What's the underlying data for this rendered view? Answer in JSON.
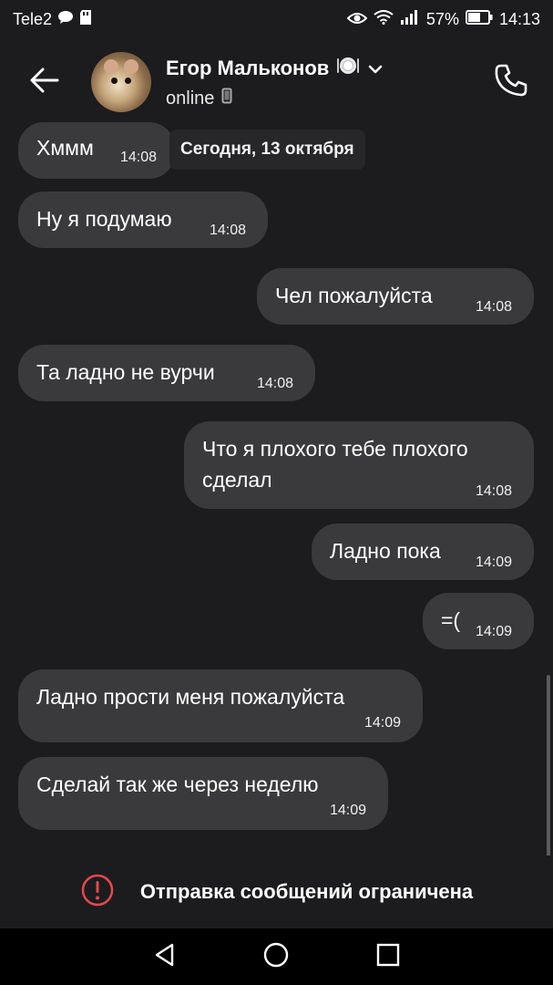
{
  "status_bar": {
    "carrier": "Tele2",
    "battery": "57%",
    "time": "14:13"
  },
  "header": {
    "contact_name": "Егор Мальконов",
    "status": "online"
  },
  "date_chip": "Сегодня, 13 октября",
  "messages": [
    {
      "text": "Хммм",
      "time": "14:08",
      "outgoing": false
    },
    {
      "text": "Ну я подумаю",
      "time": "14:08",
      "outgoing": false
    },
    {
      "text": "Чел пожалуйста",
      "time": "14:08",
      "outgoing": true
    },
    {
      "text": "Та ладно не вурчи",
      "time": "14:08",
      "outgoing": false
    },
    {
      "text_line1": "Что я плохого тебе плохого",
      "text_line2": "сделал",
      "time": "14:08",
      "outgoing": true
    },
    {
      "text": "Ладно пока",
      "time": "14:09",
      "outgoing": true
    },
    {
      "text": "=(",
      "time": "14:09",
      "outgoing": true
    },
    {
      "text": "Ладно прости меня пожалуйста",
      "time": "14:09",
      "outgoing": false
    },
    {
      "text": "Сделай так же через неделю",
      "time": "14:09",
      "outgoing": false
    }
  ],
  "banner": {
    "text": "Отправка сообщений ограничена",
    "accent_color": "#e5484d"
  },
  "icons": {
    "back": "arrow-left-icon",
    "call": "phone-icon",
    "warning": "exclamation-circle-icon",
    "nav_back": "triangle-back-icon",
    "nav_home": "circle-home-icon",
    "nav_recents": "square-recents-icon"
  }
}
